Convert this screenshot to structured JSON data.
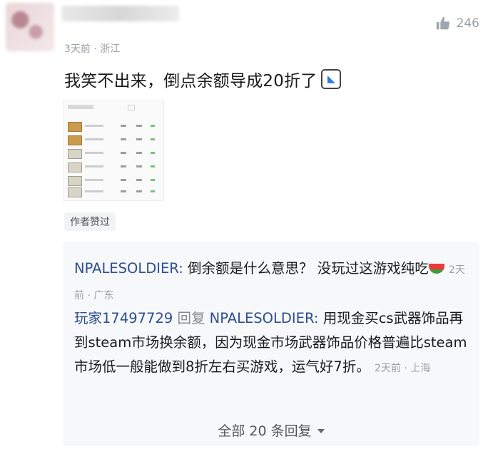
{
  "comment": {
    "meta": "3天前 · 浙江",
    "likes": "246",
    "text": "我笑不出来，倒点余额导成20折了",
    "author_tag": "作者赞过"
  },
  "replies": [
    {
      "user": "NPALESOLDIER:",
      "text": " 倒余额是什么意思？ 没玩过这游戏纯吃",
      "time": "2天前 · 广东"
    },
    {
      "user": "玩家17497729",
      "verb": " 回复 ",
      "target": "NPALESOLDIER:",
      "text": " 用现金买cs武器饰品再到steam市场换余额，因为现金市场武器饰品价格普遍比steam市场低一般能做到8折左右买游戏，运气好7折。",
      "time": "2天前 · 上海"
    }
  ],
  "footer": {
    "all_replies": "全部 20 条回复"
  },
  "icons": {
    "like": "thumbs-up-icon",
    "emoji": "dolphin-emoji-icon",
    "watermelon": "watermelon-emoji-icon",
    "caret": "chevron-down-icon"
  }
}
